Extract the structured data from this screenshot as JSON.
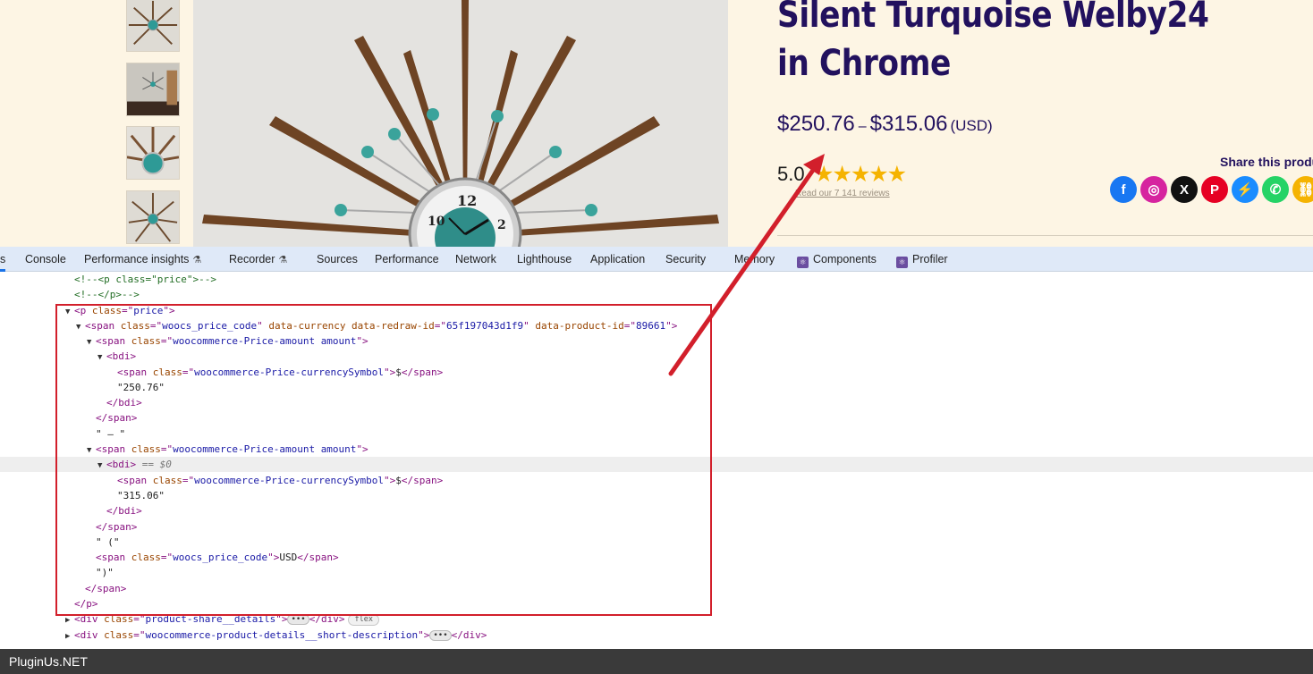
{
  "product": {
    "title": "Silent Turquoise Welby24 in Chrome",
    "price_from": "$250.76",
    "price_sep": "–",
    "price_to": "$315.06",
    "currency": "(USD)",
    "rating": "5.0",
    "stars": "★★★★★",
    "reviews_link": "Read our 7 141 reviews",
    "share_title": "Share this product",
    "share_icons": [
      {
        "name": "facebook-icon",
        "color": "#1877f2",
        "glyph": "f"
      },
      {
        "name": "instagram-icon",
        "color": "#d6249f",
        "glyph": "◎"
      },
      {
        "name": "x-icon",
        "color": "#111111",
        "glyph": "X"
      },
      {
        "name": "pinterest-icon",
        "color": "#e60023",
        "glyph": "P"
      },
      {
        "name": "messenger-icon",
        "color": "#1a8cff",
        "glyph": "⚡"
      },
      {
        "name": "whatsapp-icon",
        "color": "#25d366",
        "glyph": "✆"
      },
      {
        "name": "copy-link-icon",
        "color": "#f5b301",
        "glyph": "⛓"
      }
    ]
  },
  "devtools": {
    "tabs": [
      {
        "label": "s",
        "name": "tab-elements"
      },
      {
        "label": "Console",
        "name": "tab-console"
      },
      {
        "label": "Performance insights",
        "name": "tab-performance-insights",
        "flask": true
      },
      {
        "label": "Recorder",
        "name": "tab-recorder",
        "flask": true
      },
      {
        "label": "Sources",
        "name": "tab-sources"
      },
      {
        "label": "Performance",
        "name": "tab-performance"
      },
      {
        "label": "Network",
        "name": "tab-network"
      },
      {
        "label": "Lighthouse",
        "name": "tab-lighthouse"
      },
      {
        "label": "Application",
        "name": "tab-application"
      },
      {
        "label": "Security",
        "name": "tab-security"
      },
      {
        "label": "Memory",
        "name": "tab-memory"
      },
      {
        "label": "Components",
        "name": "tab-components",
        "react": true
      },
      {
        "label": "Profiler",
        "name": "tab-profiler",
        "react": true
      }
    ],
    "dom_lines": [
      {
        "indent": 83,
        "parts": [
          [
            "cmt",
            "<!--<p class=\"price\">-->"
          ]
        ]
      },
      {
        "indent": 83,
        "parts": [
          [
            "cmt",
            "<!--</p>-->"
          ]
        ]
      },
      {
        "indent": 73,
        "tri": "▼",
        "parts": [
          [
            "tag",
            "<p "
          ],
          [
            "an",
            "class"
          ],
          [
            "tag",
            "=\""
          ],
          [
            "av",
            "price"
          ],
          [
            "tag",
            "\">"
          ]
        ]
      },
      {
        "indent": 85,
        "tri": "▼",
        "parts": [
          [
            "tag",
            "<span "
          ],
          [
            "an",
            "class"
          ],
          [
            "tag",
            "=\""
          ],
          [
            "av",
            "woocs_price_code"
          ],
          [
            "tag",
            "\" "
          ],
          [
            "an",
            "data-currency data-redraw-id"
          ],
          [
            "tag",
            "=\""
          ],
          [
            "av",
            "65f197043d1f9"
          ],
          [
            "tag",
            "\" "
          ],
          [
            "an",
            "data-product-id"
          ],
          [
            "tag",
            "=\""
          ],
          [
            "av",
            "89661"
          ],
          [
            "tag",
            "\">"
          ]
        ]
      },
      {
        "indent": 97,
        "tri": "▼",
        "parts": [
          [
            "tag",
            "<span "
          ],
          [
            "an",
            "class"
          ],
          [
            "tag",
            "=\""
          ],
          [
            "av",
            "woocommerce-Price-amount amount"
          ],
          [
            "tag",
            "\">"
          ]
        ]
      },
      {
        "indent": 109,
        "tri": "▼",
        "parts": [
          [
            "tag",
            "<bdi>"
          ]
        ]
      },
      {
        "indent": 131,
        "parts": [
          [
            "tag",
            "<span "
          ],
          [
            "an",
            "class"
          ],
          [
            "tag",
            "=\""
          ],
          [
            "av",
            "woocommerce-Price-currencySymbol"
          ],
          [
            "tag",
            "\">"
          ],
          [
            "txt",
            "$"
          ],
          [
            "tag",
            "</span>"
          ]
        ]
      },
      {
        "indent": 131,
        "parts": [
          [
            "txt",
            "\"250.76\""
          ]
        ]
      },
      {
        "indent": 119,
        "parts": [
          [
            "tag",
            "</bdi>"
          ]
        ]
      },
      {
        "indent": 107,
        "parts": [
          [
            "tag",
            "</span>"
          ]
        ]
      },
      {
        "indent": 107,
        "parts": [
          [
            "txt",
            "\" – \""
          ]
        ]
      },
      {
        "indent": 97,
        "tri": "▼",
        "parts": [
          [
            "tag",
            "<span "
          ],
          [
            "an",
            "class"
          ],
          [
            "tag",
            "=\""
          ],
          [
            "av",
            "woocommerce-Price-amount amount"
          ],
          [
            "tag",
            "\">"
          ]
        ]
      },
      {
        "indent": 109,
        "tri": "▼",
        "sel": true,
        "parts": [
          [
            "tag",
            "<bdi>"
          ],
          [
            "eq",
            " == $0"
          ]
        ]
      },
      {
        "indent": 131,
        "parts": [
          [
            "tag",
            "<span "
          ],
          [
            "an",
            "class"
          ],
          [
            "tag",
            "=\""
          ],
          [
            "av",
            "woocommerce-Price-currencySymbol"
          ],
          [
            "tag",
            "\">"
          ],
          [
            "txt",
            "$"
          ],
          [
            "tag",
            "</span>"
          ]
        ]
      },
      {
        "indent": 131,
        "parts": [
          [
            "txt",
            "\"315.06\""
          ]
        ]
      },
      {
        "indent": 119,
        "parts": [
          [
            "tag",
            "</bdi>"
          ]
        ]
      },
      {
        "indent": 107,
        "parts": [
          [
            "tag",
            "</span>"
          ]
        ]
      },
      {
        "indent": 107,
        "parts": [
          [
            "txt",
            "\" (\""
          ]
        ]
      },
      {
        "indent": 107,
        "parts": [
          [
            "tag",
            "<span "
          ],
          [
            "an",
            "class"
          ],
          [
            "tag",
            "=\""
          ],
          [
            "av",
            "woocs_price_code"
          ],
          [
            "tag",
            "\">"
          ],
          [
            "txt",
            "USD"
          ],
          [
            "tag",
            "</span>"
          ]
        ]
      },
      {
        "indent": 107,
        "parts": [
          [
            "txt",
            "\")\""
          ]
        ]
      },
      {
        "indent": 95,
        "parts": [
          [
            "tag",
            "</span>"
          ]
        ]
      },
      {
        "indent": 83,
        "parts": [
          [
            "tag",
            "</p>"
          ]
        ]
      },
      {
        "indent": 73,
        "tri": "▶",
        "parts": [
          [
            "tag",
            "<div "
          ],
          [
            "an",
            "class"
          ],
          [
            "tag",
            "=\""
          ],
          [
            "av",
            "product-share__details"
          ],
          [
            "tag",
            "\">"
          ],
          [
            "dots",
            "•••"
          ],
          [
            "tag",
            "</div>"
          ],
          [
            "badge",
            "flex"
          ]
        ]
      },
      {
        "indent": 73,
        "tri": "▶",
        "parts": [
          [
            "tag",
            "<div "
          ],
          [
            "an",
            "class"
          ],
          [
            "tag",
            "=\""
          ],
          [
            "av",
            "woocommerce-product-details__short-description"
          ],
          [
            "tag",
            "\">"
          ],
          [
            "dots",
            "•••"
          ],
          [
            "tag",
            "</div>"
          ]
        ]
      }
    ]
  },
  "footer": {
    "label": "PluginUs.NET"
  },
  "colors": {
    "title": "#22115e",
    "highlight": "#d21f2b",
    "star": "#f5b301"
  }
}
